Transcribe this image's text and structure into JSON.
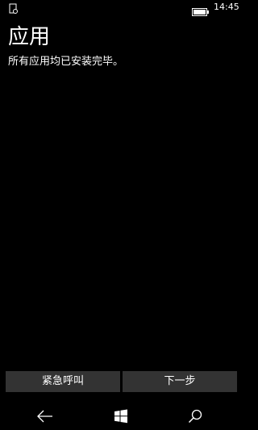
{
  "status_bar": {
    "left_icon": "sim-status-icon",
    "battery_icon": "battery-icon",
    "time": "14:45"
  },
  "page": {
    "title": "应用",
    "subtitle": "所有应用均已安装完毕。"
  },
  "buttons": {
    "emergency_label": "紧急呼叫",
    "next_label": "下一步"
  },
  "nav_bar": {
    "back_icon": "back-arrow-icon",
    "start_icon": "windows-start-icon",
    "search_icon": "search-icon"
  },
  "colors": {
    "background": "#000000",
    "button_background": "#333333",
    "text": "#ffffff"
  }
}
